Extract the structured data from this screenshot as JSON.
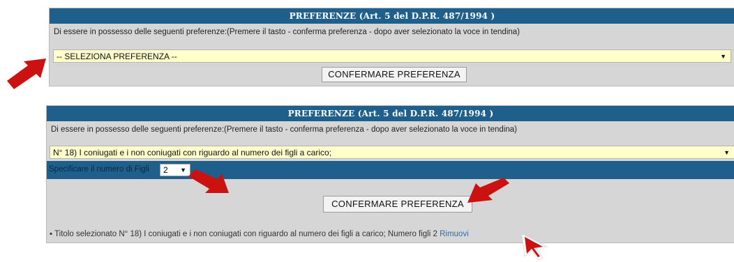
{
  "panel1": {
    "header": "PREFERENZE (Art. 5 del D.P.R. 487/1994 )",
    "instruction": "Di essere in possesso delle seguenti preferenze:(Premere il tasto - conferma preferenza - dopo aver selezionato la voce in tendina)",
    "select_value": "-- SELEZIONA PREFERENZA --",
    "confirm_label": "CONFERMARE PREFERENZA"
  },
  "panel2": {
    "header": "PREFERENZE (Art. 5 del D.P.R. 487/1994 )",
    "instruction": "Di essere in possesso delle seguenti preferenze:(Premere il tasto - conferma preferenza - dopo aver selezionato la voce in tendina)",
    "select_value": "N° 18) I coniugati e i non coniugati con riguardo al numero dei figli a carico;",
    "figli_label": "Specificare il numero di Figli",
    "figli_value": "2",
    "confirm_label": "CONFERMARE PREFERENZA",
    "summary_bullet": "▪",
    "summary_text": "Titolo selezionato N° 18) I coniugati e i non coniugati con riguardo al numero dei figli a carico; Numero figli 2",
    "remove_link": "Rimuovi"
  },
  "icons": {
    "dropdown": "▼",
    "annotation": "red-arrow-icon",
    "cursor": "cursor-pointer-icon"
  },
  "colors": {
    "header_bg": "#1f5f8b",
    "select_bg": "#ffffcc",
    "panel_bg": "#d6d6d6",
    "annotation_red": "#cc1111"
  }
}
